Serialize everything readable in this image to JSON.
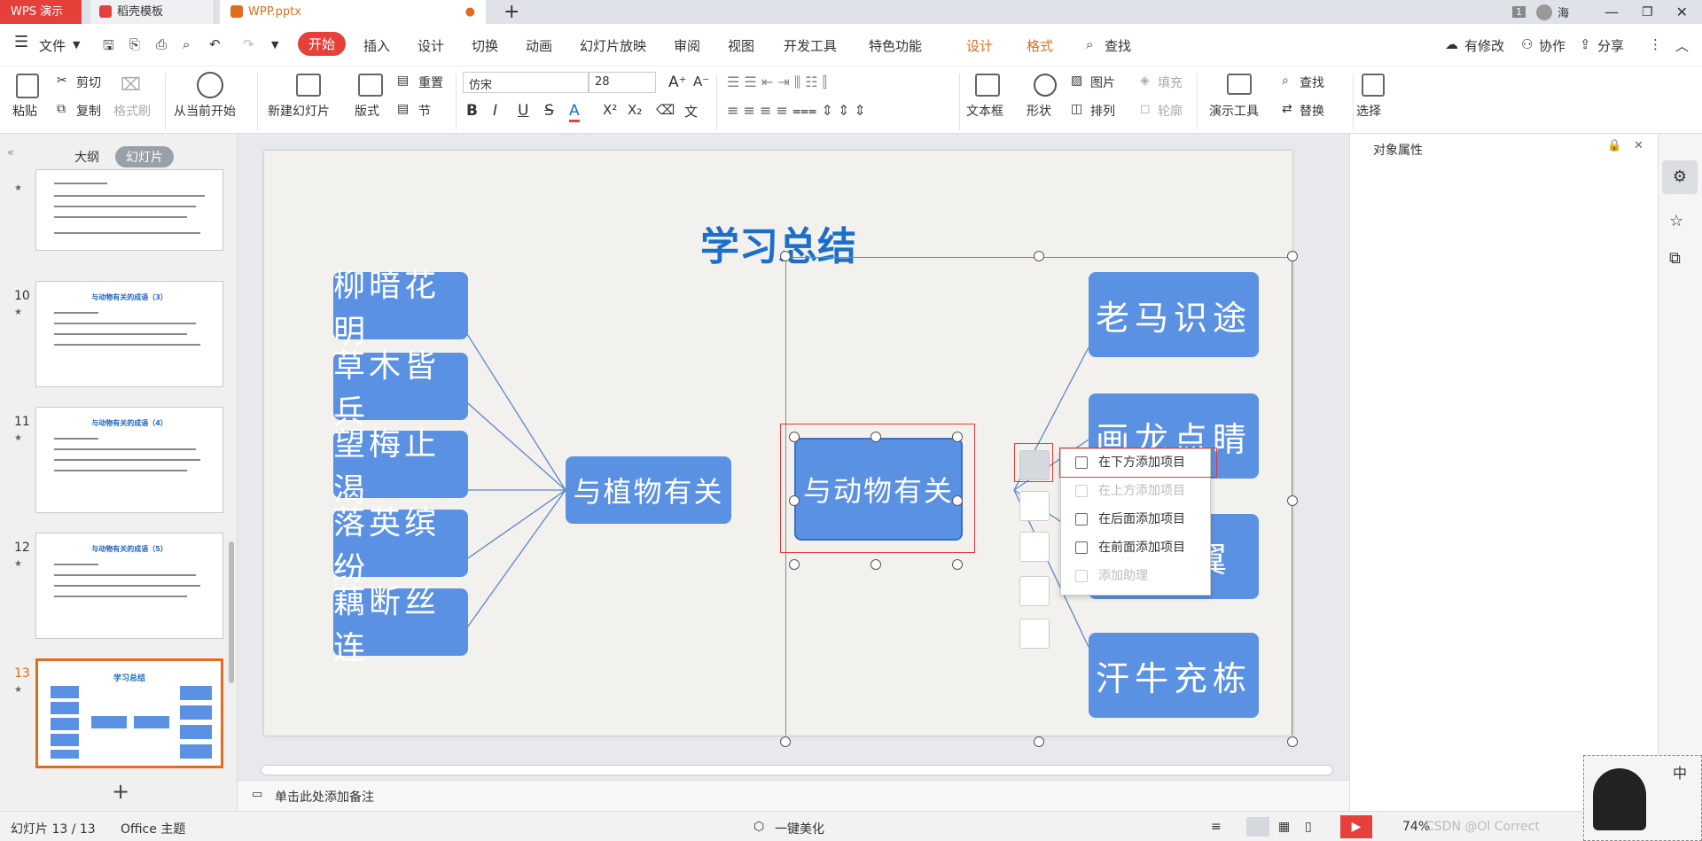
{
  "tabs": {
    "wps": "WPS 演示",
    "daoke": "稻壳模板",
    "file": "WPP.pptx",
    "add": "+"
  },
  "window": {
    "page_badge": "1",
    "user": "海"
  },
  "menu": {
    "file": "文件",
    "items": [
      "开始",
      "插入",
      "设计",
      "切换",
      "动画",
      "幻灯片放映",
      "审阅",
      "视图",
      "开发工具",
      "特色功能"
    ],
    "context_tabs": [
      "设计",
      "格式"
    ],
    "search": "查找",
    "modified": "有修改",
    "collab": "协作",
    "share": "分享"
  },
  "ribbon": {
    "paste": "粘贴",
    "cut": "剪切",
    "copy": "复制",
    "format_painter": "格式刷",
    "play_from_current": "从当前开始",
    "new_slide": "新建幻灯片",
    "layout": "版式",
    "reset": "重置",
    "section": "节",
    "font": "仿宋",
    "size": "28",
    "textbox": "文本框",
    "shape": "形状",
    "picture": "图片",
    "fill": "填充",
    "arrange": "排列",
    "outline": "轮廓",
    "presentation_tools": "演示工具",
    "find": "查找",
    "replace": "替换",
    "select": "选择"
  },
  "left_panel": {
    "tab_outline": "大纲",
    "tab_slides": "幻灯片",
    "slides": [
      {
        "num": "",
        "title": ""
      },
      {
        "num": "10",
        "title": "与动物有关的成语（3）"
      },
      {
        "num": "11",
        "title": "与动物有关的成语（4）"
      },
      {
        "num": "12",
        "title": "与动物有关的成语（5）"
      },
      {
        "num": "13",
        "title": "学习总结"
      }
    ]
  },
  "slide": {
    "title": "学习总结",
    "left_items": [
      "柳暗花明",
      "草木皆兵",
      "望梅止渴",
      "落英缤纷",
      "藕断丝连"
    ],
    "center_left": "与植物有关",
    "center_right": "与动物有关",
    "right_items": [
      "老马识途",
      "画龙点睛",
      "添翼",
      "汗牛充栋"
    ]
  },
  "context_menu": {
    "items": [
      {
        "label": "在下方添加项目",
        "enabled": true
      },
      {
        "label": "在上方添加项目",
        "enabled": false
      },
      {
        "label": "在后面添加项目",
        "enabled": true
      },
      {
        "label": "在前面添加项目",
        "enabled": true
      },
      {
        "label": "添加助理",
        "enabled": false
      }
    ]
  },
  "notes": {
    "placeholder": "单击此处添加备注"
  },
  "right_panel": {
    "title": "对象属性"
  },
  "status": {
    "slide_count": "幻灯片 13 / 13",
    "theme": "Office 主题",
    "beautify": "一键美化",
    "zoom": "74%",
    "watermark": "CSDN @Ol Correct",
    "ime": "中"
  },
  "colors": {
    "accent": "#e5403a",
    "node": "#5b91e2",
    "title": "#1b6fc8",
    "orange": "#e06c1d"
  }
}
